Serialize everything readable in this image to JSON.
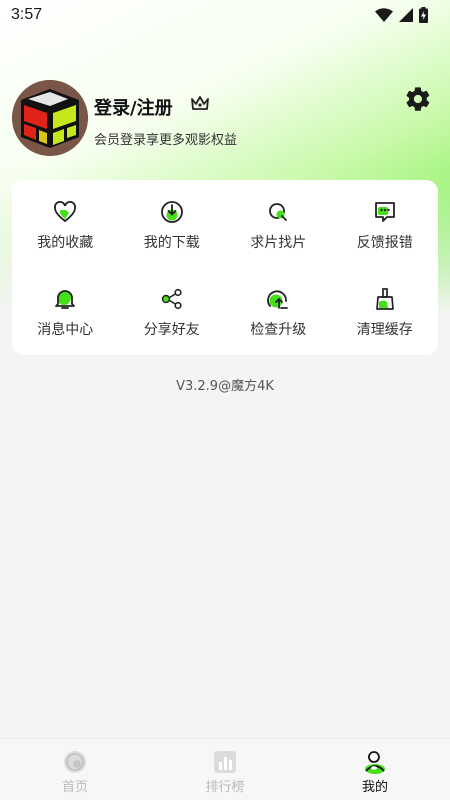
{
  "status_bar": {
    "time": "3:57",
    "icons": [
      "wifi-icon",
      "signal-icon",
      "battery-charging-icon"
    ]
  },
  "profile": {
    "title": "登录/注册",
    "subtitle": "会员登录享更多观影权益",
    "avatar_icon": "rubiks-cube-avatar",
    "badge_icon": "crown-icon",
    "settings_icon": "gear-icon"
  },
  "menu": [
    {
      "label": "我的收藏",
      "icon": "heart-icon"
    },
    {
      "label": "我的下载",
      "icon": "download-icon"
    },
    {
      "label": "求片找片",
      "icon": "search-film-icon"
    },
    {
      "label": "反馈报错",
      "icon": "feedback-icon"
    },
    {
      "label": "消息中心",
      "icon": "bell-icon"
    },
    {
      "label": "分享好友",
      "icon": "share-icon"
    },
    {
      "label": "检查升级",
      "icon": "upgrade-icon"
    },
    {
      "label": "清理缓存",
      "icon": "broom-icon"
    }
  ],
  "version": "V3.2.9@魔方4K",
  "bottom_nav": [
    {
      "label": "首页",
      "icon": "home-icon",
      "active": false
    },
    {
      "label": "排行榜",
      "icon": "ranking-icon",
      "active": false
    },
    {
      "label": "我的",
      "icon": "profile-icon",
      "active": true
    }
  ],
  "colors": {
    "accent": "#52ea20",
    "text": "#333333",
    "inactive": "#bbbbbb"
  }
}
